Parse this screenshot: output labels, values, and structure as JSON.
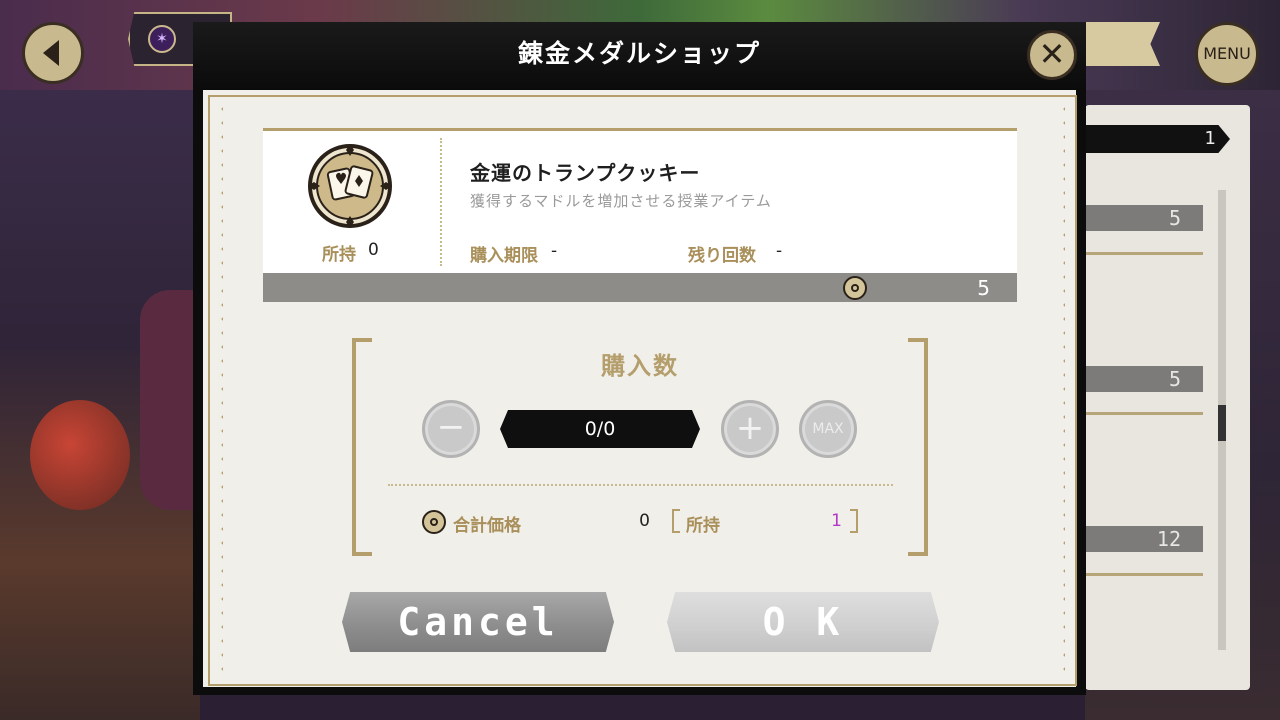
{
  "modal": {
    "title": "錬金メダルショップ",
    "close_label": "✕"
  },
  "topbar": {
    "menu_label": "MENU"
  },
  "item": {
    "name": "金運のトランプクッキー",
    "description": "獲得するマドルを増加させる授業アイテム",
    "owned_label": "所持",
    "owned_value": "0",
    "deadline_label": "購入期限",
    "deadline_value": "-",
    "remaining_label": "残り回数",
    "remaining_value": "-",
    "price": "5"
  },
  "purchase": {
    "title": "購入数",
    "minus_label": "−",
    "plus_label": "+",
    "max_label": "MAX",
    "quantity": "0/0",
    "total_label": "合計価格",
    "total_value": "0",
    "balance_label": "所持",
    "balance_value": "1"
  },
  "buttons": {
    "cancel": "Cancel",
    "ok": "O K"
  },
  "background_list": {
    "top_badge": "1",
    "prices": [
      "5",
      "5",
      "12"
    ]
  },
  "colors": {
    "accent_gold": "#b49e6c",
    "balance_purple": "#b438c8",
    "header_black": "#0c0c0c"
  }
}
